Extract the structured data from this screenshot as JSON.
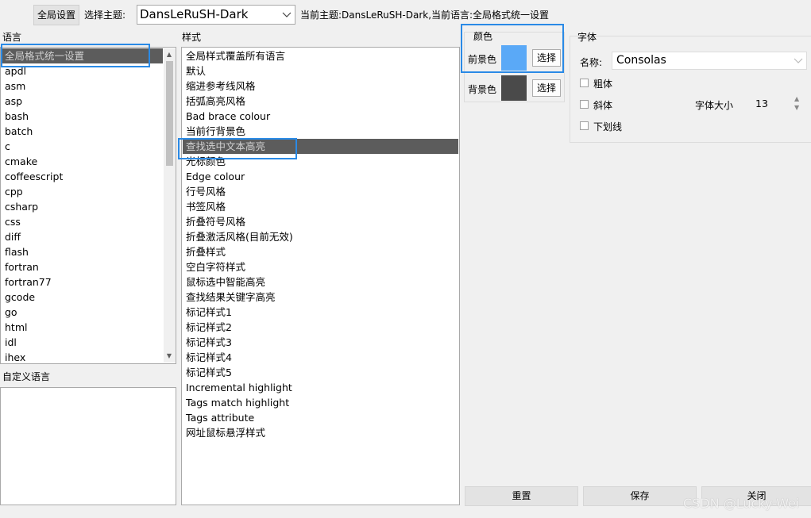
{
  "toolbar": {
    "global_settings_label": "全局设置",
    "select_theme_label": "选择主题:",
    "theme_value": "DansLeRuSH-Dark",
    "status_text": "当前主题:DansLeRuSH-Dark,当前语言:全局格式统一设置"
  },
  "languages": {
    "header": "语言",
    "selected_index": 0,
    "items": [
      "全局格式统一设置",
      "apdl",
      "asm",
      "asp",
      "bash",
      "batch",
      "c",
      "cmake",
      "coffeescript",
      "cpp",
      "csharp",
      "css",
      "diff",
      "flash",
      "fortran",
      "fortran77",
      "gcode",
      "go",
      "html",
      "idl",
      "ihex"
    ]
  },
  "custom_language": {
    "header": "自定义语言"
  },
  "styles": {
    "header": "样式",
    "selected_index": 6,
    "items": [
      "全局样式覆盖所有语言",
      "默认",
      "缩进参考线风格",
      "括弧高亮风格",
      "Bad brace colour",
      "当前行背景色",
      "查找选中文本高亮",
      "光标颜色",
      "Edge colour",
      "行号风格",
      "书签风格",
      "折叠符号风格",
      "折叠激活风格(目前无效)",
      "折叠样式",
      "空白字符样式",
      "鼠标选中智能高亮",
      "查找结果关键字高亮",
      "标记样式1",
      "标记样式2",
      "标记样式3",
      "标记样式4",
      "标记样式5",
      "Incremental highlight",
      "Tags match highlight",
      "Tags attribute",
      "网址鼠标悬浮样式"
    ]
  },
  "color": {
    "header": "颜色",
    "foreground_label": "前景色",
    "foreground_color": "#5aa9f7",
    "background_label": "背景色",
    "background_color": "#4a4a4a",
    "select_label": "选择"
  },
  "font": {
    "header": "字体",
    "name_label": "名称:",
    "name_value": "Consolas",
    "bold_label": "粗体",
    "italic_label": "斜体",
    "underline_label": "下划线",
    "size_label": "字体大小",
    "size_value": "13"
  },
  "actions": {
    "reset_label": "重置",
    "save_label": "保存",
    "close_label": "关闭"
  },
  "watermark": "CSDN @Lucky-Wei"
}
